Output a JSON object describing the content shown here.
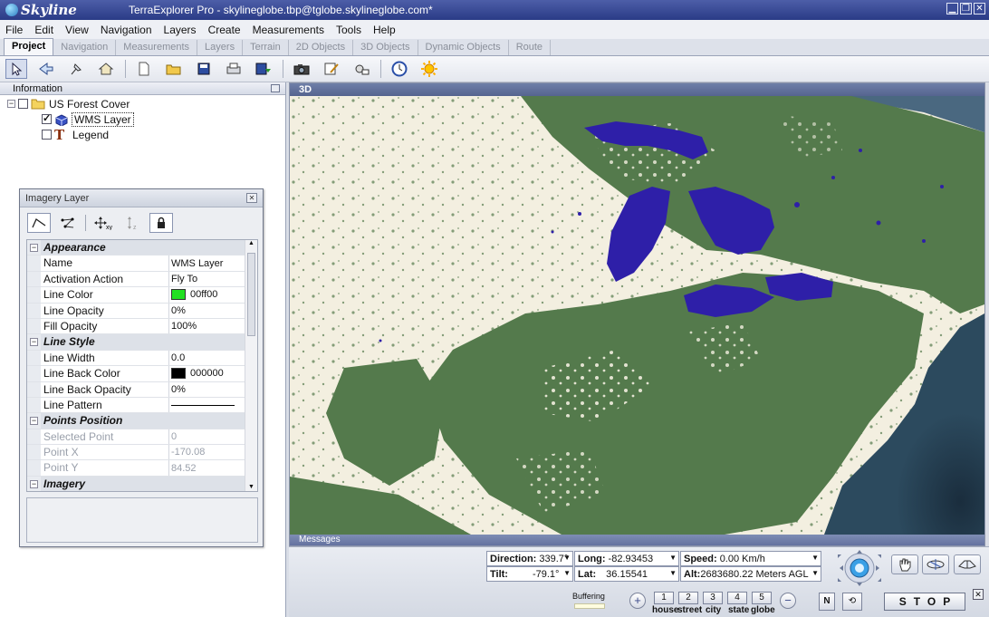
{
  "titlebar": {
    "logo": "Skyline",
    "title": "TerraExplorer Pro - skylineglobe.tbp@tglobe.skylineglobe.com*"
  },
  "menu": [
    "File",
    "Edit",
    "View",
    "Navigation",
    "Layers",
    "Create",
    "Measurements",
    "Tools",
    "Help"
  ],
  "tabs": [
    {
      "label": "Project",
      "active": true
    },
    {
      "label": "Navigation"
    },
    {
      "label": "Measurements"
    },
    {
      "label": "Layers"
    },
    {
      "label": "Terrain"
    },
    {
      "label": "2D Objects"
    },
    {
      "label": "3D Objects"
    },
    {
      "label": "Dynamic Objects"
    },
    {
      "label": "Route"
    }
  ],
  "toolbar_icons": [
    "select-arrow-icon",
    "fly-to-icon",
    "pin-icon",
    "home-icon",
    "new-project-icon",
    "open-folder-icon",
    "save-icon",
    "print-icon",
    "save-as-icon",
    "camera-icon",
    "edit-form-icon",
    "settings-tools-icon",
    "clock-icon",
    "sun-icon"
  ],
  "info_panel": {
    "title": "Information",
    "tree": {
      "root": "US Forest Cover",
      "children": [
        {
          "label": "WMS Layer",
          "checked": true
        },
        {
          "label": "Legend",
          "checked": false
        }
      ]
    }
  },
  "imagery_window": {
    "title": "Imagery Layer",
    "properties": [
      {
        "type": "category",
        "name": "Appearance"
      },
      {
        "name": "Name",
        "value": "WMS Layer"
      },
      {
        "name": "Activation Action",
        "value": "Fly To"
      },
      {
        "name": "Line Color",
        "value": "00ff00",
        "swatch": "#22e022"
      },
      {
        "name": "Line Opacity",
        "value": "0%"
      },
      {
        "name": "Fill Opacity",
        "value": "100%"
      },
      {
        "type": "category",
        "name": "Line Style"
      },
      {
        "name": "Line Width",
        "value": "0.0"
      },
      {
        "name": "Line Back Color",
        "value": "000000",
        "swatch": "#000000"
      },
      {
        "name": "Line Back Opacity",
        "value": "0%"
      },
      {
        "name": "Line Pattern",
        "value": "",
        "pattern": true
      },
      {
        "type": "category",
        "name": "Points Position"
      },
      {
        "name": "Selected Point",
        "value": "0",
        "disabled": true
      },
      {
        "name": "Point X",
        "value": "-170.08",
        "disabled": true
      },
      {
        "name": "Point Y",
        "value": "84.52",
        "disabled": true
      },
      {
        "type": "category",
        "name": "Imagery"
      }
    ]
  },
  "view3d": {
    "title": "3D",
    "messages_label": "Messages"
  },
  "status": {
    "direction_label": "Direction:",
    "direction": "339.7°",
    "tilt_label": "Tilt:",
    "tilt": "-79.1°",
    "long_label": "Long:",
    "long": "-82.93453",
    "lat_label": "Lat:",
    "lat": "36.15541",
    "speed_label": "Speed:",
    "speed": "0.00 Km/h",
    "alt_label": "Alt:",
    "alt": "2683680.22 Meters AGL",
    "buffering": "Buffering",
    "zoom_levels": [
      {
        "num": "1",
        "label": "house"
      },
      {
        "num": "2",
        "label": "street"
      },
      {
        "num": "3",
        "label": "city"
      },
      {
        "num": "4",
        "label": "state"
      },
      {
        "num": "5",
        "label": "globe"
      }
    ],
    "north_label": "N",
    "stop_label": "STOP"
  },
  "colors": {
    "forest": "#547a4c",
    "open": "#f3efe0",
    "water": "#2e1fa8",
    "ocean": "#1e3648",
    "titlebar": "#2a3b86"
  }
}
